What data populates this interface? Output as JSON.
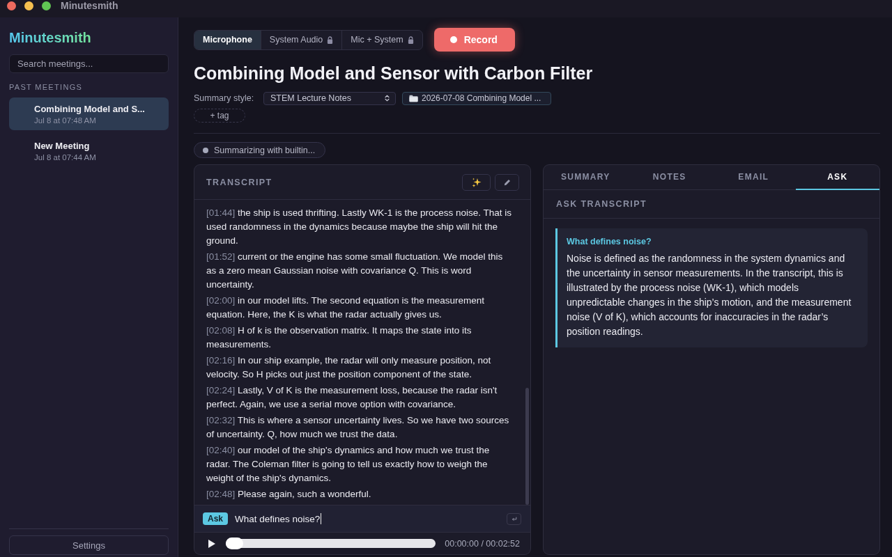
{
  "window": {
    "title": "Minutesmith"
  },
  "sidebar": {
    "logo": "Minutesmith",
    "search": {
      "placeholder": "Search meetings..."
    },
    "section_label": "PAST MEETINGS",
    "meetings": [
      {
        "title": "Combining Model and S...",
        "time": "Jul 8 at 07:48 AM",
        "selected": true
      },
      {
        "title": "New Meeting",
        "time": "Jul 8 at 07:44 AM",
        "selected": false
      }
    ],
    "settings_button": "Settings"
  },
  "source_tabs": [
    {
      "label": "Microphone",
      "selected": true,
      "locked": false
    },
    {
      "label": "System Audio",
      "selected": false,
      "locked": true
    },
    {
      "label": "Mic + System",
      "selected": false,
      "locked": true
    }
  ],
  "record_button": "Record",
  "meeting": {
    "title": "Combining Model and Sensor with Carbon Filter",
    "summary_style_label": "Summary style:",
    "summary_style": "STEM Lecture Notes",
    "folder": "2026-07-08 Combining Model ...",
    "tag_button": "+ tag"
  },
  "status": "Summarizing with builtin...",
  "transcript": {
    "heading": "TRANSCRIPT",
    "entries": [
      {
        "time": "[01:44]",
        "text": "the ship is used thrifting. Lastly WK-1 is the process noise. That is used randomness in the dynamics because maybe the ship will hit the ground."
      },
      {
        "time": "[01:52]",
        "text": "current or the engine has some small fluctuation. We model this as a zero mean Gaussian noise with covariance Q. This is word uncertainty."
      },
      {
        "time": "[02:00]",
        "text": "in our model lifts. The second equation is the measurement equation. Here, the K is what the radar actually gives us."
      },
      {
        "time": "[02:08]",
        "text": "H of k is the observation matrix. It maps the state into its measurements."
      },
      {
        "time": "[02:16]",
        "text": "In our ship example, the radar will only measure position, not velocity. So H picks out just the position component of the state."
      },
      {
        "time": "[02:24]",
        "text": "Lastly, V of K is the measurement loss, because the radar isn't perfect. Again, we use a serial move option with covariance."
      },
      {
        "time": "[02:32]",
        "text": "This is where a sensor uncertainty lives. So we have two sources of uncertainty. Q, how much we trust the data."
      },
      {
        "time": "[02:40]",
        "text": "our model of the ship's dynamics and how much we trust the radar. The Coleman filter is going to tell us exactly how to weigh the weight of the ship's dynamics."
      },
      {
        "time": "[02:48]",
        "text": "Please again, such a wonderful."
      }
    ],
    "ask": {
      "label": "Ask",
      "value": "What defines noise?"
    },
    "player": {
      "level": 0,
      "time": "00:00:00 / 00:02:52"
    }
  },
  "right_panel": {
    "tabs": [
      {
        "label": "SUMMARY",
        "selected": false
      },
      {
        "label": "NOTES",
        "selected": false
      },
      {
        "label": "EMAIL",
        "selected": false
      },
      {
        "label": "ASK",
        "selected": true
      }
    ],
    "heading": "ASK TRANSCRIPT",
    "answers": [
      {
        "question": "What defines noise?",
        "answer": "Noise is defined as the randomness in the system dynamics and the uncertainty in sensor measurements. In the transcript, this is illustrated by the process noise (WK-1), which models unpredictable changes in the ship’s motion, and the measurement noise (V of K), which accounts for inaccuracies in the radar’s position readings."
      }
    ]
  }
}
